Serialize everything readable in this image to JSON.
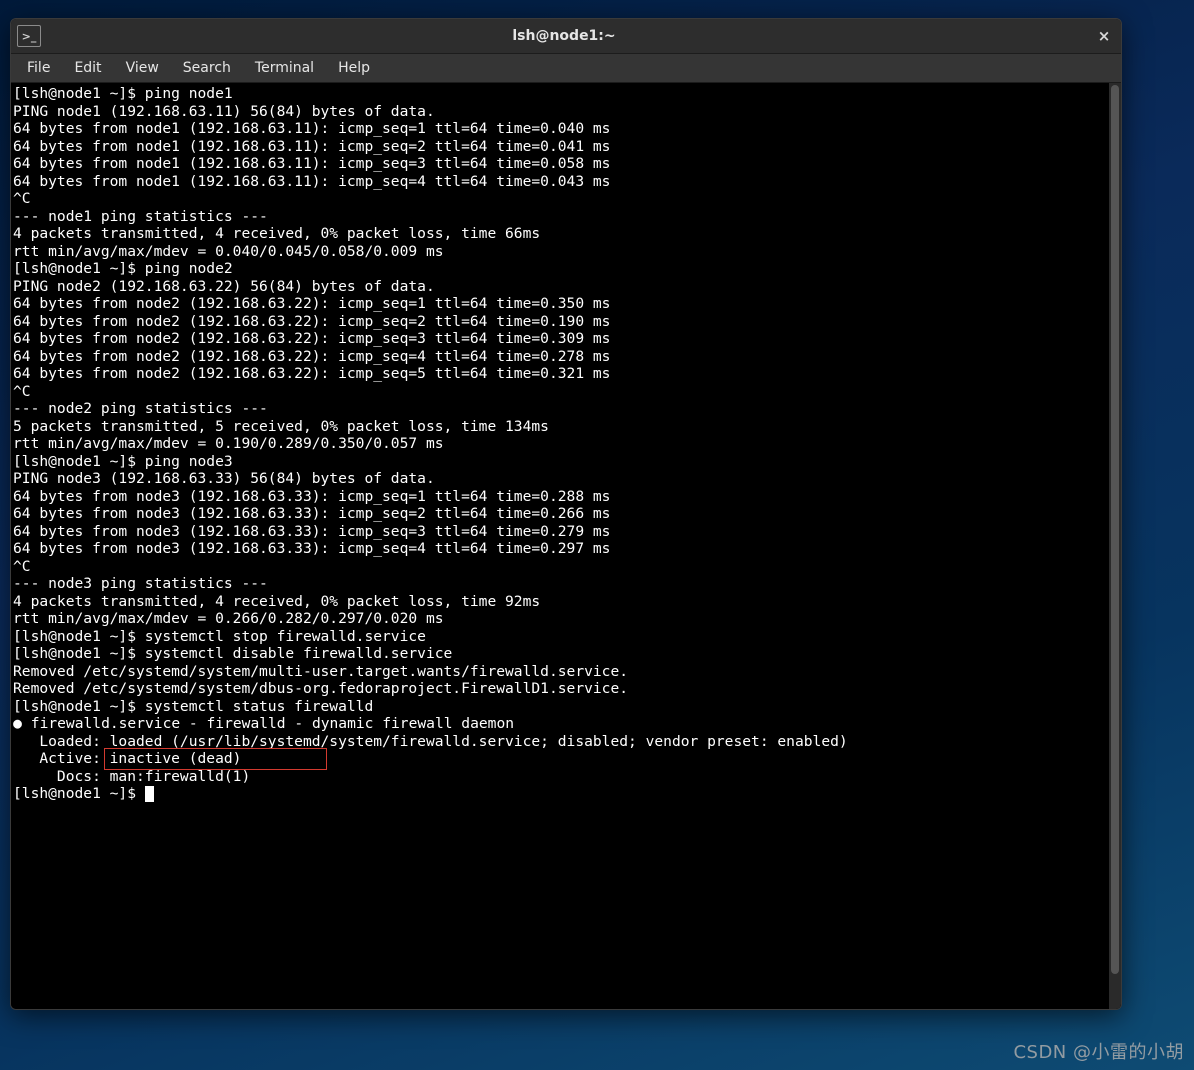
{
  "window": {
    "title": "lsh@node1:~",
    "app_icon": ">_",
    "close_symbol": "×"
  },
  "menu": {
    "file": "File",
    "edit": "Edit",
    "view": "View",
    "search": "Search",
    "terminal": "Terminal",
    "help": "Help"
  },
  "terminal": {
    "lines": [
      "[lsh@node1 ~]$ ping node1",
      "PING node1 (192.168.63.11) 56(84) bytes of data.",
      "64 bytes from node1 (192.168.63.11): icmp_seq=1 ttl=64 time=0.040 ms",
      "64 bytes from node1 (192.168.63.11): icmp_seq=2 ttl=64 time=0.041 ms",
      "64 bytes from node1 (192.168.63.11): icmp_seq=3 ttl=64 time=0.058 ms",
      "64 bytes from node1 (192.168.63.11): icmp_seq=4 ttl=64 time=0.043 ms",
      "^C",
      "--- node1 ping statistics ---",
      "4 packets transmitted, 4 received, 0% packet loss, time 66ms",
      "rtt min/avg/max/mdev = 0.040/0.045/0.058/0.009 ms",
      "[lsh@node1 ~]$ ping node2",
      "PING node2 (192.168.63.22) 56(84) bytes of data.",
      "64 bytes from node2 (192.168.63.22): icmp_seq=1 ttl=64 time=0.350 ms",
      "64 bytes from node2 (192.168.63.22): icmp_seq=2 ttl=64 time=0.190 ms",
      "64 bytes from node2 (192.168.63.22): icmp_seq=3 ttl=64 time=0.309 ms",
      "64 bytes from node2 (192.168.63.22): icmp_seq=4 ttl=64 time=0.278 ms",
      "64 bytes from node2 (192.168.63.22): icmp_seq=5 ttl=64 time=0.321 ms",
      "^C",
      "--- node2 ping statistics ---",
      "5 packets transmitted, 5 received, 0% packet loss, time 134ms",
      "rtt min/avg/max/mdev = 0.190/0.289/0.350/0.057 ms",
      "[lsh@node1 ~]$ ping node3",
      "PING node3 (192.168.63.33) 56(84) bytes of data.",
      "64 bytes from node3 (192.168.63.33): icmp_seq=1 ttl=64 time=0.288 ms",
      "64 bytes from node3 (192.168.63.33): icmp_seq=2 ttl=64 time=0.266 ms",
      "64 bytes from node3 (192.168.63.33): icmp_seq=3 ttl=64 time=0.279 ms",
      "64 bytes from node3 (192.168.63.33): icmp_seq=4 ttl=64 time=0.297 ms",
      "^C",
      "--- node3 ping statistics ---",
      "4 packets transmitted, 4 received, 0% packet loss, time 92ms",
      "rtt min/avg/max/mdev = 0.266/0.282/0.297/0.020 ms",
      "[lsh@node1 ~]$ systemctl stop firewalld.service",
      "[lsh@node1 ~]$ systemctl disable firewalld.service",
      "Removed /etc/systemd/system/multi-user.target.wants/firewalld.service.",
      "Removed /etc/systemd/system/dbus-org.fedoraproject.FirewallD1.service.",
      "[lsh@node1 ~]$ systemctl status firewalld",
      "● firewalld.service - firewalld - dynamic firewall daemon",
      "   Loaded: loaded (/usr/lib/systemd/system/firewalld.service; disabled; vendor preset: enabled)",
      "   Active: inactive (dead)",
      "     Docs: man:firewalld(1)",
      "[lsh@node1 ~]$ "
    ],
    "highlight_text": "inactive (dead)"
  },
  "watermark": "CSDN @小雷的小胡"
}
